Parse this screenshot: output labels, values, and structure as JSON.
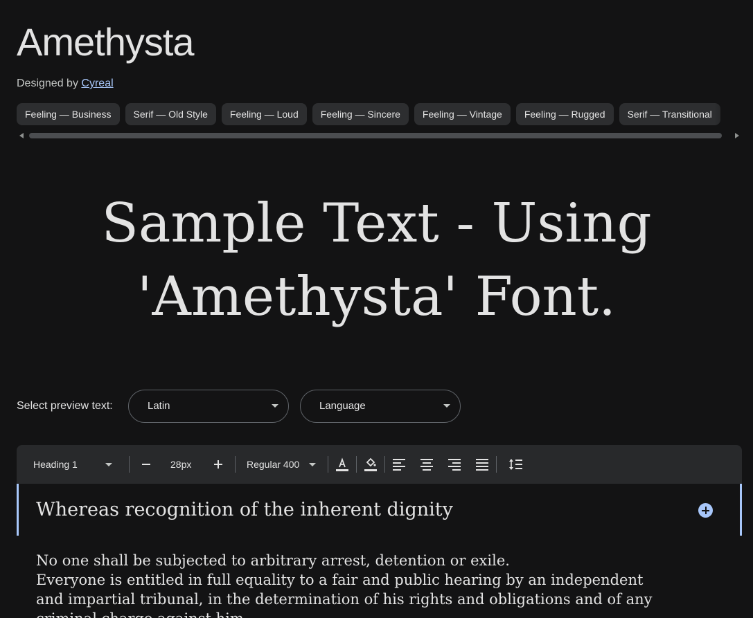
{
  "font_name": "Amethysta",
  "designer": {
    "prefix": "Designed by",
    "name": "Cyreal"
  },
  "tags": [
    "Feeling — Business",
    "Serif — Old Style",
    "Feeling — Loud",
    "Feeling — Sincere",
    "Feeling — Vintage",
    "Feeling — Rugged",
    "Serif — Transitional"
  ],
  "sample": {
    "line1": "Sample Text - Using",
    "line2": "'Amethysta' Font."
  },
  "preview": {
    "label": "Select preview text:",
    "script_value": "Latin",
    "language_value": "Language"
  },
  "toolbar": {
    "style_value": "Heading 1",
    "size_value": "28px",
    "weight_value": "Regular 400",
    "decrease_icon": "minus-icon",
    "increase_icon": "plus-icon",
    "text_color_icon": "text-color-icon",
    "highlight_icon": "fill-color-icon",
    "align_icons": [
      "align-left-icon",
      "align-center-icon",
      "align-right-icon",
      "align-justify-icon"
    ],
    "line_height_icon": "line-height-icon"
  },
  "editor": {
    "heading": "Whereas recognition of the inherent dignity",
    "paragraph_lines": [
      "No one shall be subjected to arbitrary arrest, detention or exile.",
      "Everyone is entitled in full equality to a fair and public hearing by an independent",
      "and impartial tribunal, in the determination of his rights and obligations and of any",
      "criminal charge against him."
    ]
  },
  "colors": {
    "background": "#131314",
    "surface": "#28292b",
    "chip": "#2d2e30",
    "accent": "#a8c7fa",
    "text": "#e3e3e3"
  }
}
